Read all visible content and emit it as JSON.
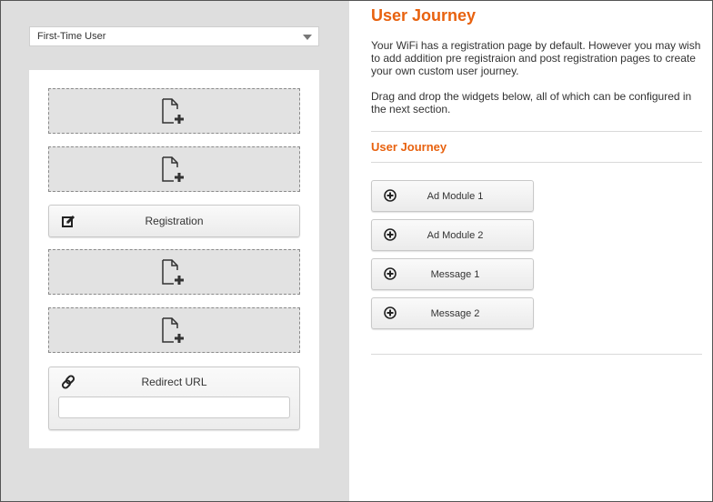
{
  "left": {
    "user_type_select": {
      "value": "First-Time User"
    },
    "widgets": {
      "registration": {
        "label": "Registration"
      },
      "redirect": {
        "label": "Redirect URL",
        "input_value": ""
      }
    }
  },
  "right": {
    "title": "User Journey",
    "description": "Your WiFi has a registration page by default. However you may wish to add addition pre registraion and post registration pages to create your own custom user journey.",
    "instructions": "Drag and drop the widgets below, all of which can be configured in the next section.",
    "section_title": "User Journey",
    "palette": [
      {
        "label": "Ad Module 1"
      },
      {
        "label": "Ad Module 2"
      },
      {
        "label": "Message 1"
      },
      {
        "label": "Message 2"
      }
    ]
  },
  "icons": {
    "empty_slot": "file-add-icon",
    "registration": "edit-icon",
    "redirect": "link-icon",
    "palette_item": "plus-circle-icon"
  },
  "colors": {
    "accent": "#e8620f",
    "panel_bg": "#dedede"
  }
}
